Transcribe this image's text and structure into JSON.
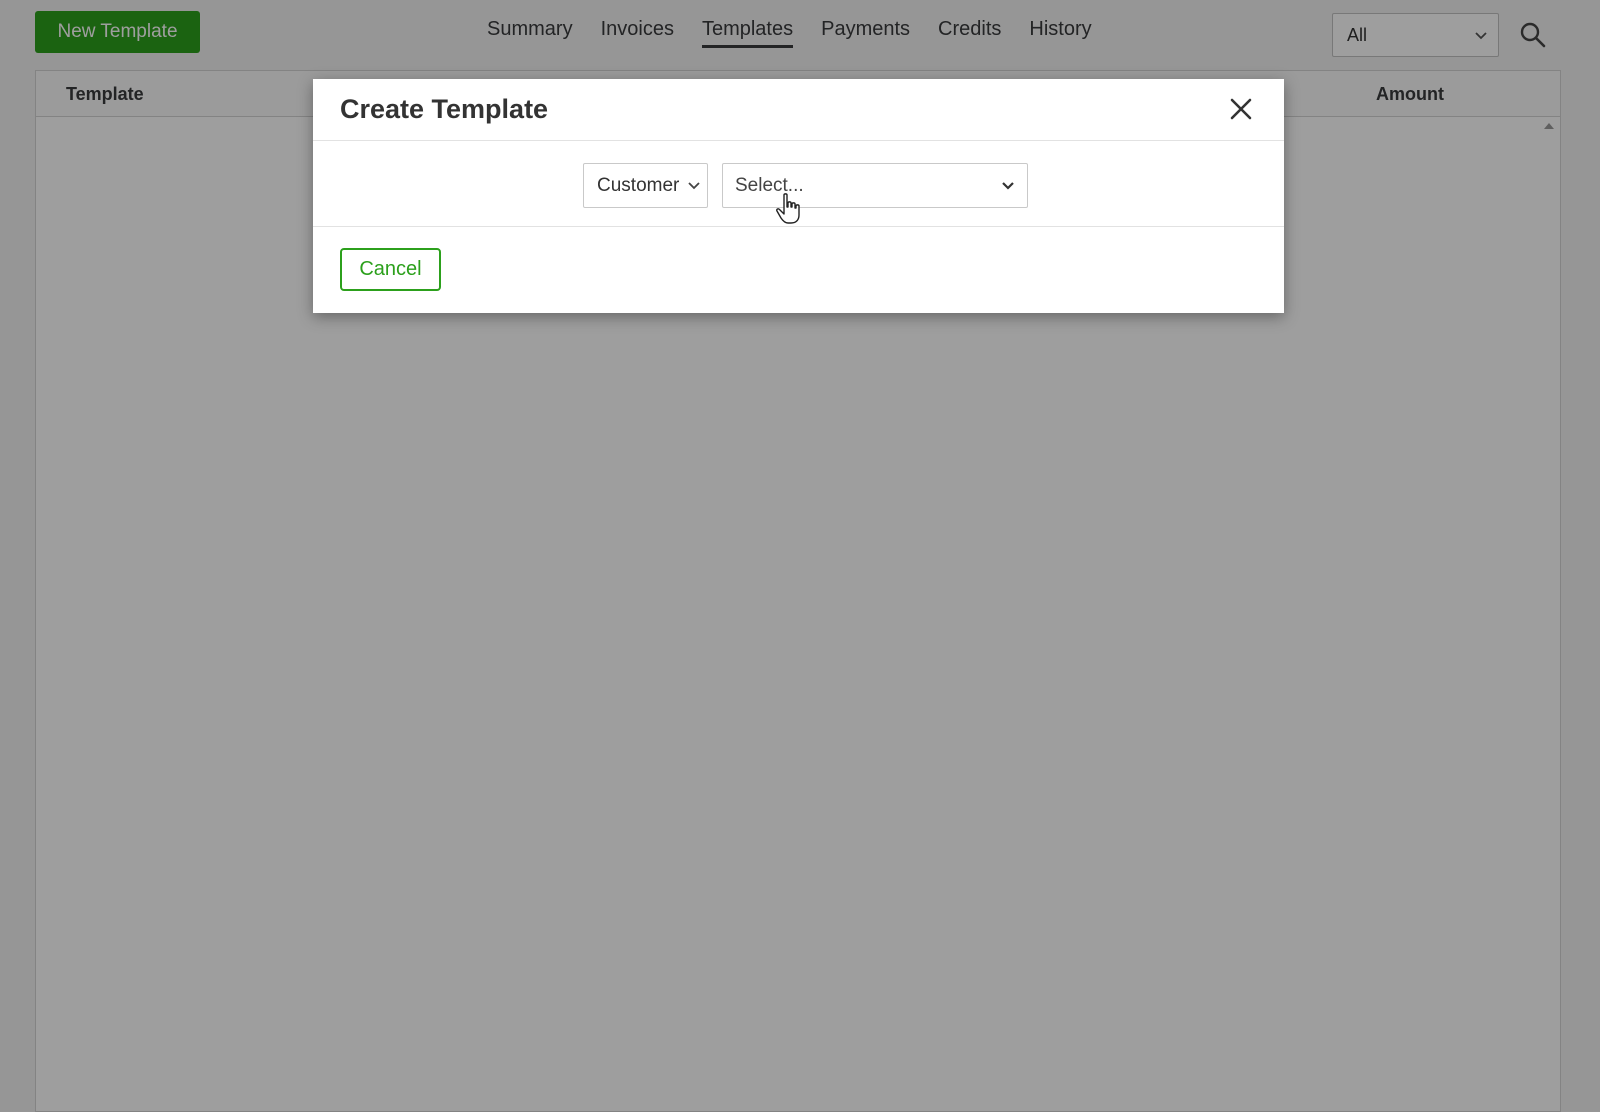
{
  "toolbar": {
    "new_template_label": "New Template"
  },
  "nav": {
    "tabs": [
      {
        "label": "Summary",
        "active": false
      },
      {
        "label": "Invoices",
        "active": false
      },
      {
        "label": "Templates",
        "active": true
      },
      {
        "label": "Payments",
        "active": false
      },
      {
        "label": "Credits",
        "active": false
      },
      {
        "label": "History",
        "active": false
      }
    ]
  },
  "filter": {
    "selected": "All"
  },
  "table": {
    "columns": [
      "Template",
      "Amount"
    ]
  },
  "modal": {
    "title": "Create Template",
    "type_select": "Customer",
    "customer_select_placeholder": "Select...",
    "cancel_label": "Cancel"
  },
  "colors": {
    "accent_green": "#2ca01c",
    "overlay": "rgba(0,0,0,0.38)"
  },
  "icons": {
    "search": "search-icon",
    "close": "close-icon",
    "chevron": "chevron-down-icon",
    "cursor": "hand-pointer-icon"
  }
}
